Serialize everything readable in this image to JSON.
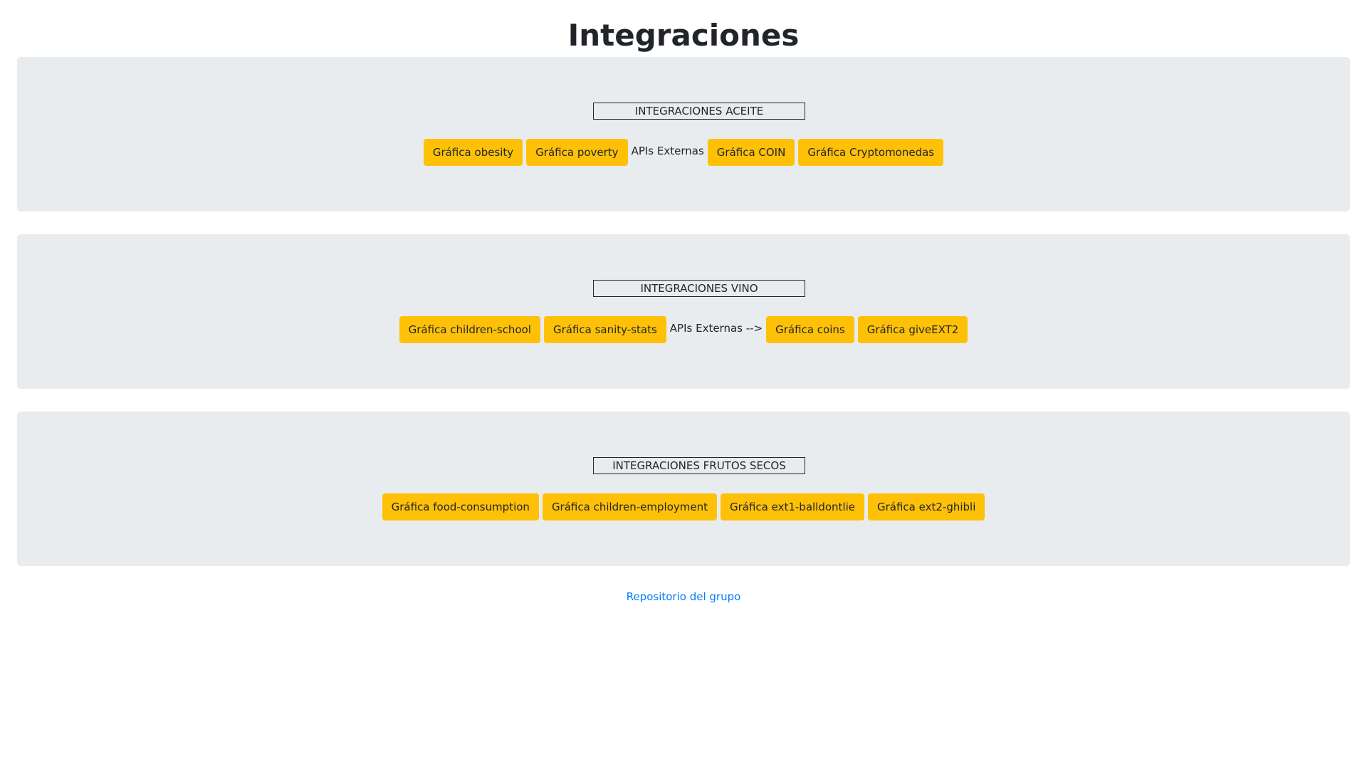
{
  "page": {
    "title": "Integraciones"
  },
  "sections": [
    {
      "heading": "INTEGRACIONES ACEITE",
      "buttons_before": [
        "Gráfica obesity",
        "Gráfica poverty"
      ],
      "separator": "APIs Externas",
      "buttons_after": [
        "Gráfica COIN",
        "Gráfica Cryptomonedas"
      ]
    },
    {
      "heading": "INTEGRACIONES VINO",
      "buttons_before": [
        "Gráfica children-school",
        "Gráfica sanity-stats"
      ],
      "separator": "APIs Externas -->",
      "buttons_after": [
        "Gráfica coins",
        "Gráfica giveEXT2"
      ]
    },
    {
      "heading": "INTEGRACIONES FRUTOS SECOS",
      "buttons": [
        "Gráfica food-consumption",
        "Gráfica children-employment",
        "Gráfica ext1-balldontlie",
        "Gráfica ext2-ghibli"
      ]
    }
  ],
  "footer": {
    "link_text": "Repositorio del grupo"
  },
  "colors": {
    "button_bg": "#ffc107",
    "section_bg": "#e9ecef",
    "link": "#007bff"
  }
}
